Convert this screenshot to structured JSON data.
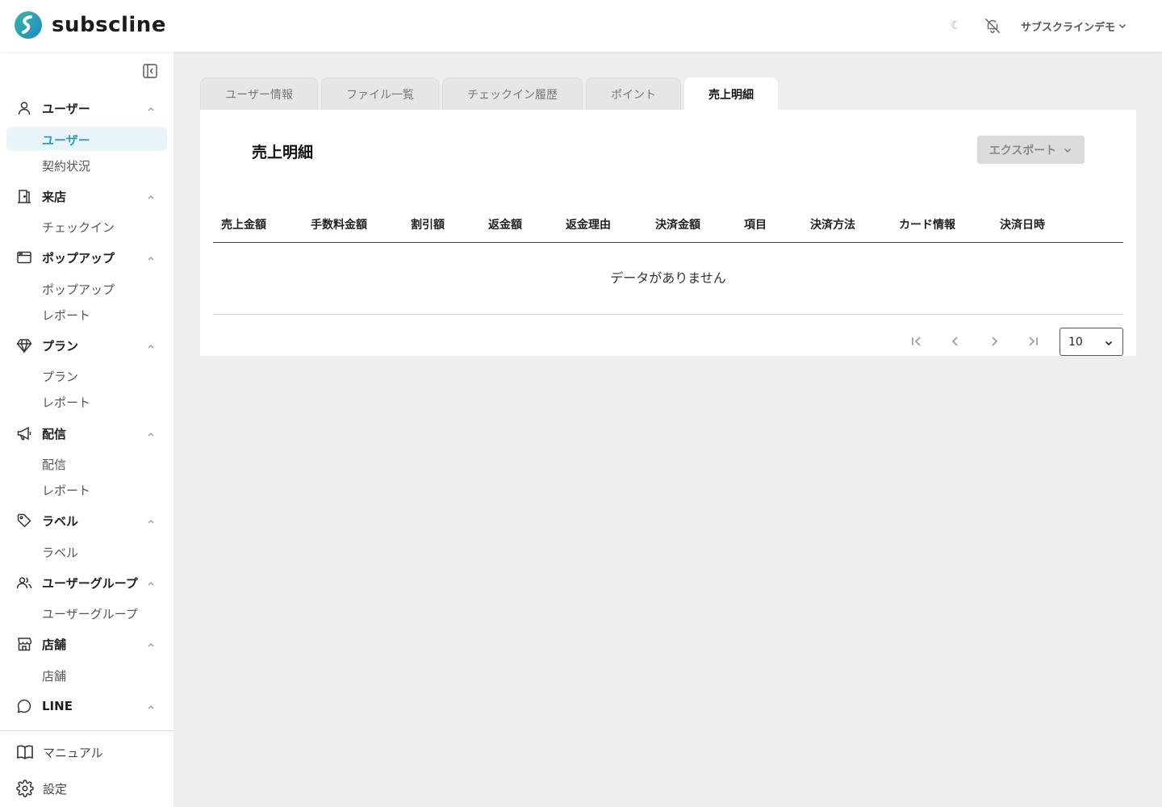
{
  "app": {
    "logo_text": "subscline"
  },
  "header": {
    "theme_glyph": "☾",
    "account_label": "サブスクラインデモ"
  },
  "sidebar": {
    "groups": [
      {
        "label": "ユーザー",
        "icon": "user-icon",
        "items": [
          "ユーザー",
          "契約状況"
        ],
        "active_item": "ユーザー"
      },
      {
        "label": "来店",
        "icon": "door-icon",
        "items": [
          "チェックイン"
        ]
      },
      {
        "label": "ポップアップ",
        "icon": "window-icon",
        "items": [
          "ポップアップ",
          "レポート"
        ]
      },
      {
        "label": "プラン",
        "icon": "gem-icon",
        "items": [
          "プラン",
          "レポート"
        ]
      },
      {
        "label": "配信",
        "icon": "megaphone-icon",
        "items": [
          "配信",
          "レポート"
        ]
      },
      {
        "label": "ラベル",
        "icon": "tag-icon",
        "items": [
          "ラベル"
        ]
      },
      {
        "label": "ユーザーグループ",
        "icon": "users-icon",
        "items": [
          "ユーザーグループ"
        ]
      },
      {
        "label": "店舗",
        "icon": "store-icon",
        "items": [
          "店舗"
        ]
      },
      {
        "label": "LINE",
        "icon": "chat-bubble-icon",
        "items": []
      }
    ],
    "footer": [
      {
        "label": "マニュアル",
        "icon": "book-icon"
      },
      {
        "label": "設定",
        "icon": "gear-icon"
      }
    ]
  },
  "tabs": [
    "ユーザー情報",
    "ファイル一覧",
    "チェックイン履歴",
    "ポイント",
    "売上明細"
  ],
  "active_tab": "売上明細",
  "panel": {
    "title": "売上明細",
    "export_label": "エクスポート",
    "columns": [
      "売上金額",
      "手数料金額",
      "割引額",
      "返金額",
      "返金理由",
      "決済金額",
      "項目",
      "決済方法",
      "カード情報",
      "決済日時"
    ],
    "empty_text": "データがありません",
    "rows_per_page": "10"
  },
  "colors": {
    "accent": "#2a9fb8",
    "active_bg": "#e8f4f7",
    "page_bg": "#eeeeee"
  }
}
